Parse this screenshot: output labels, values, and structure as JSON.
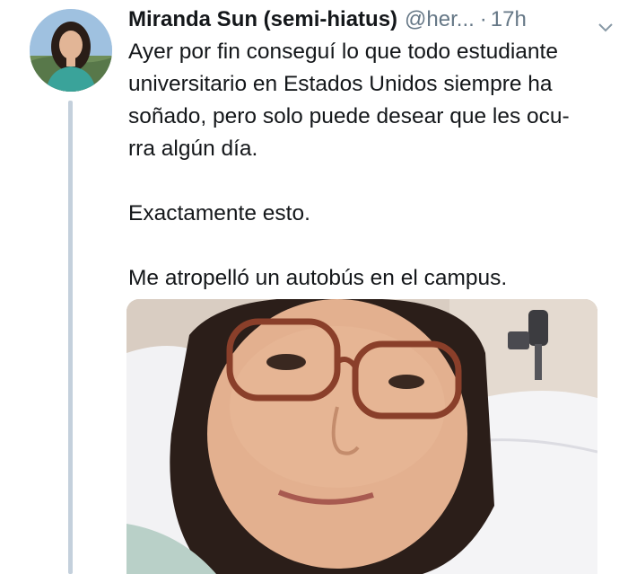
{
  "tweet": {
    "display_name": "Miranda Sun (semi-hiatus)",
    "handle": "@her...",
    "separator": "·",
    "time": "17h",
    "lines": [
      "Ayer por fin conseguí lo que todo estudiante",
      "universitario en Estados Unidos siempre ha",
      "soñado, pero solo puede desear que les ocu-",
      "rra algún día.",
      "",
      "Exactamente esto.",
      "",
      "Me atropelló un autobús en el campus."
    ]
  },
  "icons": {
    "more": "chevron-down-icon"
  },
  "colors": {
    "text": "#14171a",
    "secondary": "#657786",
    "thread_line": "#c4d0dc"
  }
}
